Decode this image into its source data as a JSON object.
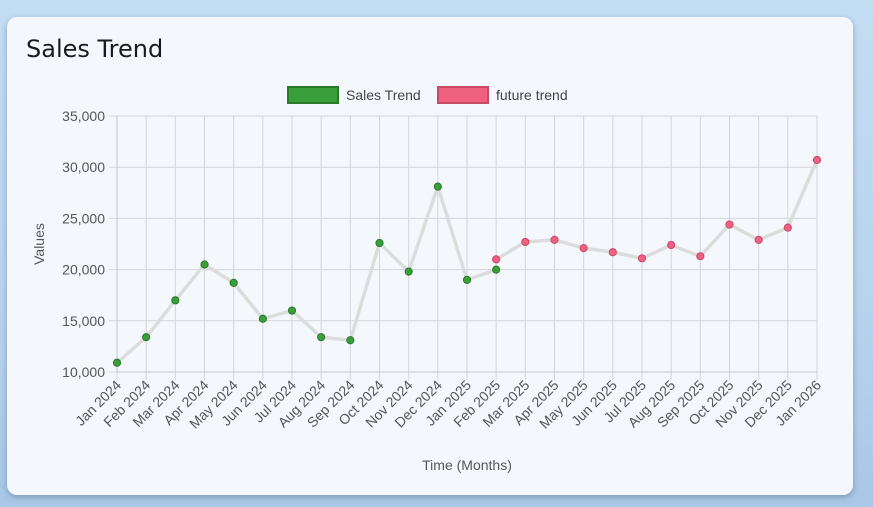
{
  "card": {
    "title": "Sales Trend"
  },
  "chart_data": {
    "type": "line",
    "xlabel": "Time (Months)",
    "ylabel": "Values",
    "ylim": [
      10000,
      35000
    ],
    "yticks": [
      10000,
      15000,
      20000,
      25000,
      30000,
      35000
    ],
    "ytick_labels": [
      "10,000",
      "15,000",
      "20,000",
      "25,000",
      "30,000",
      "35,000"
    ],
    "categories": [
      "Jan 2024",
      "Feb 2024",
      "Mar 2024",
      "Apr 2024",
      "May 2024",
      "Jun 2024",
      "Jul 2024",
      "Aug 2024",
      "Sep 2024",
      "Oct 2024",
      "Nov 2024",
      "Dec 2024",
      "Jan 2025",
      "Feb 2025",
      "Mar 2025",
      "Apr 2025",
      "May 2025",
      "Jun 2025",
      "Jul 2025",
      "Aug 2025",
      "Sep 2025",
      "Oct 2025",
      "Nov 2025",
      "Dec 2025",
      "Jan 2026"
    ],
    "grid": true,
    "legend_position": "top",
    "line_color": "#dcdcdc",
    "series": [
      {
        "name": "Sales Trend",
        "color": "#3a9e3a",
        "points": [
          {
            "x": "Jan 2024",
            "y": 10900
          },
          {
            "x": "Feb 2024",
            "y": 13400
          },
          {
            "x": "Mar 2024",
            "y": 17000
          },
          {
            "x": "Apr 2024",
            "y": 20500
          },
          {
            "x": "May 2024",
            "y": 18700
          },
          {
            "x": "Jun 2024",
            "y": 15200
          },
          {
            "x": "Jul 2024",
            "y": 16000
          },
          {
            "x": "Aug 2024",
            "y": 13400
          },
          {
            "x": "Sep 2024",
            "y": 13100
          },
          {
            "x": "Oct 2024",
            "y": 22600
          },
          {
            "x": "Nov 2024",
            "y": 19800
          },
          {
            "x": "Dec 2024",
            "y": 28100
          },
          {
            "x": "Jan 2025",
            "y": 19000
          },
          {
            "x": "Feb 2025",
            "y": 20000
          }
        ]
      },
      {
        "name": "future trend",
        "color": "#f06080",
        "points": [
          {
            "x": "Feb 2025",
            "y": 21000
          },
          {
            "x": "Mar 2025",
            "y": 22700
          },
          {
            "x": "Apr 2025",
            "y": 22900
          },
          {
            "x": "May 2025",
            "y": 22100
          },
          {
            "x": "Jun 2025",
            "y": 21700
          },
          {
            "x": "Jul 2025",
            "y": 21100
          },
          {
            "x": "Aug 2025",
            "y": 22400
          },
          {
            "x": "Sep 2025",
            "y": 21300
          },
          {
            "x": "Oct 2025",
            "y": 24400
          },
          {
            "x": "Nov 2025",
            "y": 22900
          },
          {
            "x": "Dec 2025",
            "y": 24100
          },
          {
            "x": "Jan 2026",
            "y": 30700
          }
        ]
      }
    ]
  }
}
